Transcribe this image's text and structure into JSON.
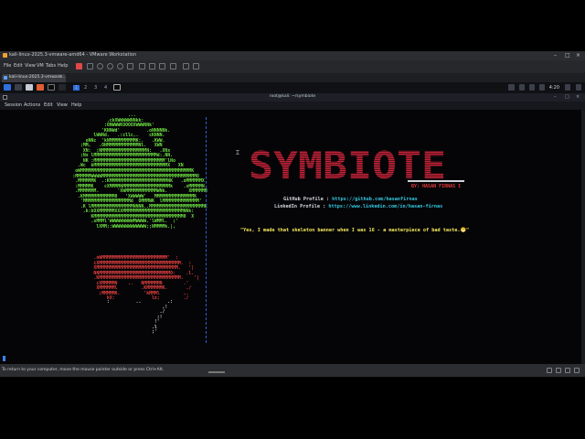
{
  "vmware": {
    "window_title": "kali-linux-2025.3-vmware-amd64 - VMware Workstation",
    "menu": [
      "File",
      "Edit",
      "View",
      "VM",
      "Tabs",
      "Help"
    ],
    "tab_label": "kali-linux-2025.3-vmware...",
    "tab_close": "×",
    "status_text": "To return to your computer, move the mouse pointer outside or press Ctrl+Alt.",
    "window_controls": [
      "–",
      "□",
      "×"
    ]
  },
  "kali_panel": {
    "workspaces": [
      "1",
      "2",
      "3",
      "4"
    ],
    "active_workspace": "1",
    "clock": "4:20"
  },
  "terminal": {
    "title": "root@kali: ~/symbiote",
    "menu": [
      "Session",
      "Actions",
      "Edit",
      "View",
      "Help"
    ],
    "ascii_green": "                           ...\n                   .ckXWWWWWNNkk:\n                  :ONWWWKOOOOXWWWNNk'\n                 'KNNWd'          .oNNNNNk.\n              lWWNd.   .:cllc,.    cKNNN.\n           oNNc  'kNMMMMMMMMMMK:.   .KWW.\n         ;MM,   .ONMMMMMMMMMMMMNl.   XWN\n          XN:  ;NMMMMMMMMMMMMMMMMMN:   .XNx\n         ;Nx lMMMMMMMMMMMMMMMMMMMMMMMMd:.NN.\n          NK :MMMMMMMMMMMMMMMMMMMMMMMMMMM'lNo\n        .Wc  kMMMMMMMMMMMMMMMMMMMMMMMMMMMMX   XN\n       oWMMMMMMMMMMMMMMMMMMMMMMMMMMMMMMMMMMMMMMMMMMK\n      :MMMMMMWWWWMMMMMMMMMMMMMMMMMMMMMMMMMMMMMMMMMMMM0\n       .MMMMMMK  .:KMMMMMMMMMMMMMMMMMMMMMMNK   .oMMMMMMX\n       :MMMMMK    cXMMMMNMMMMMMMMMMMMMMMMMMk    .xMMMMMN\n       .MMMMMMM.       'XWMMMMMMMMMMMMWNk.        XMMMMMM\n        .KMMMMMMMMMMMM0   'XWWWWW'   MMMMMMMMMMMMMMMK\n         'MMMMMMMMMMMMMMMMMMd  OMMMWK  lMMMMMMMMMMMMMM'\n         .K lMMMMMMMMMMMMMMMMNNNN..MMMMMMMMMMMMMMMMMMMMMK\n          .k:kOXMMMMMMXXXMMMMMMMMMMMMMMMMMMMMMMMNNk:\n             KMMMMMMMMMMMMMMMMMMMMMMMMMMMMMMMMMM0  X\n             .xMMMl'WWWWWWWWWMWWWW.'lWMMl.  ;'\n               lXMM;:WWWWWWWWWWWWW;;NMMMMk.|,",
    "ascii_red": "              .oWMMMMMMMMMMMMMMMMMMMMMMMMM'  :\n              cXMMMMMMMMMMMMMMMMMMMMMMMMMMMMMMM.  :\n              XMMMMMMMMMMMMMMMMMMMMMMMMMMMMMMM.   '|\n              NNMMMMMMMMMMMMMMMMMMMMMMMMMMM0:    .l.\n              .KMMMMMMMMMMMMMMMMMMMMMMMMMMMMMMM.    '|\n               cXMMMMMN    ..   NMMMMMMN        .'\n               XMMMMMMl         .KMMMMMMK.       ./\n                ;MMMMMK.         'kMMMl         ,.\n                   kX:              lx;         ./",
    "ascii_white": "                   :          ..          .:\n                                        ,!\n                                       ./\n                                      ;!\n                                     !'\n                                    .l\n                                    ;'",
    "banner": "SYMBIOTE",
    "author": "BY: HASAN FIRNAS I",
    "github_label": "GitHub Profile : ",
    "github_value": "https://github.com/hasanfirnas",
    "linkedin_label": "LinkedIn Profile : ",
    "linkedin_value": "https://www.linkedin.com/in/hasan-firnas",
    "quote": "\"Yes, I made that skeleton banner when I was 16 - a masterpiece of bad taste.😁\""
  },
  "colors": {
    "banner_red": "#c9243a",
    "green_art": "#6ee042",
    "link_cyan": "#33c8e0",
    "quote_yellow": "#f2e85a",
    "divider_blue": "#3060d0"
  }
}
